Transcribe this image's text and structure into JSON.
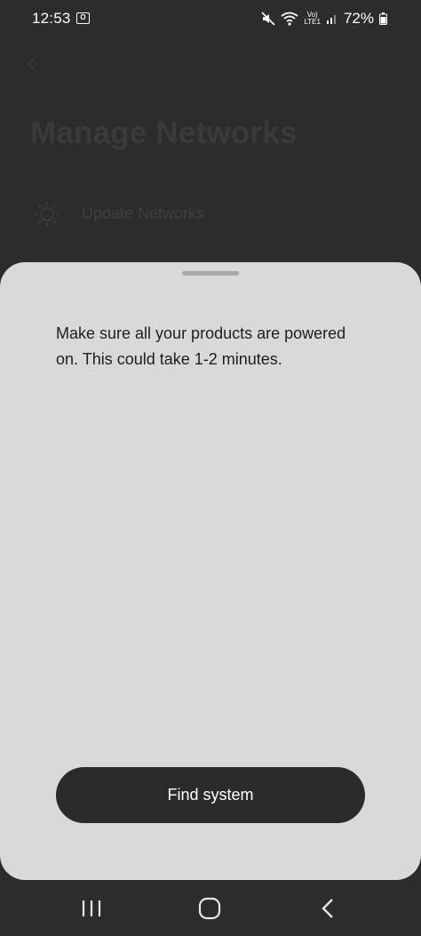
{
  "status_bar": {
    "time": "12:53",
    "app_notification_icon": "outlook-icon",
    "app_notification_letter": "O",
    "lte_top": "Vo)",
    "lte_bottom": "LTE1",
    "battery_text": "72%"
  },
  "background_page": {
    "back_icon": "chevron-left-icon",
    "title": "Manage Networks",
    "rows": [
      {
        "icon": "settings-sun-icon",
        "label": "Update Networks"
      }
    ]
  },
  "sheet": {
    "message": "Make sure all your products are powered on. This could take 1-2 minutes.",
    "button_label": "Find system"
  },
  "nav_bar": {
    "recents": "recents-icon",
    "home": "home-icon",
    "back": "back-icon"
  },
  "colors": {
    "background": "#2c2c2c",
    "sheet": "#d9d9d9",
    "button": "#2b2b2b",
    "button_text": "#ffffff"
  }
}
